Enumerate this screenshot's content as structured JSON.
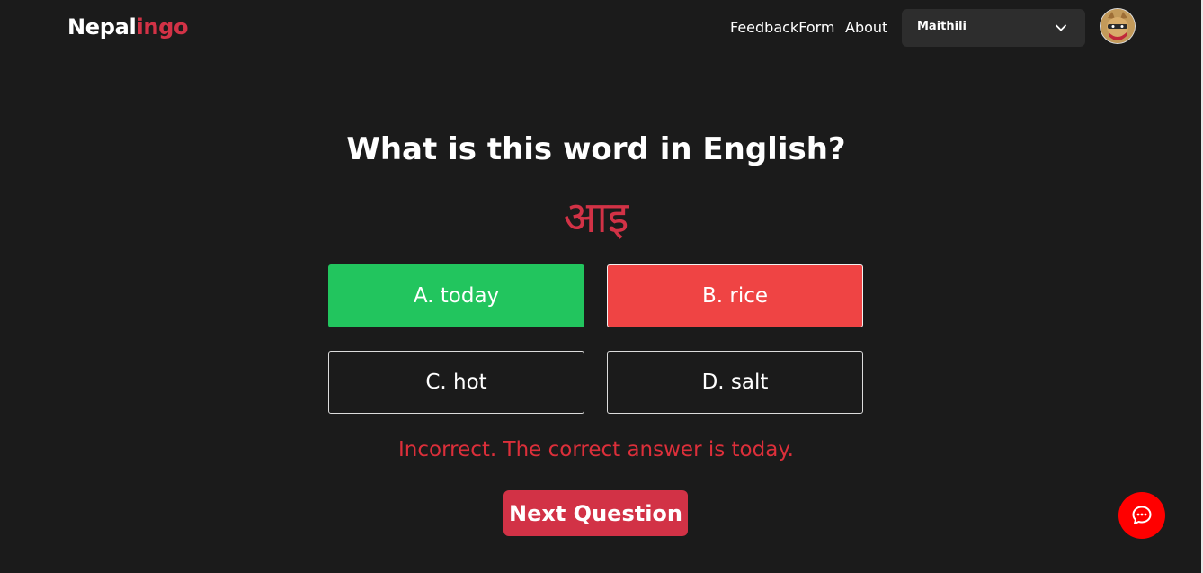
{
  "header": {
    "logo_first": "Nepal",
    "logo_second": "ingo",
    "nav": {
      "feedback_label": "FeedbackForm",
      "about_label": "About"
    },
    "language_select": {
      "selected": "Maithili"
    }
  },
  "quiz": {
    "prompt": "What is this word in English?",
    "word": "आइ",
    "options": [
      {
        "label": "A. today",
        "state": "correct"
      },
      {
        "label": "B. rice",
        "state": "incorrect-selected"
      },
      {
        "label": "C. hot",
        "state": "default"
      },
      {
        "label": "D. salt",
        "state": "default"
      }
    ],
    "feedback": "Incorrect. The correct answer is today.",
    "next_label": "Next Question"
  },
  "colors": {
    "background": "#1b1b1b",
    "brand": "#d23246",
    "correct": "#22c55e",
    "incorrect": "#ef4444",
    "chat": "#ff0000"
  },
  "icons": {
    "dropdown": "chevron-down-icon",
    "chat": "chat-bubble-icon",
    "avatar": "user-avatar"
  }
}
